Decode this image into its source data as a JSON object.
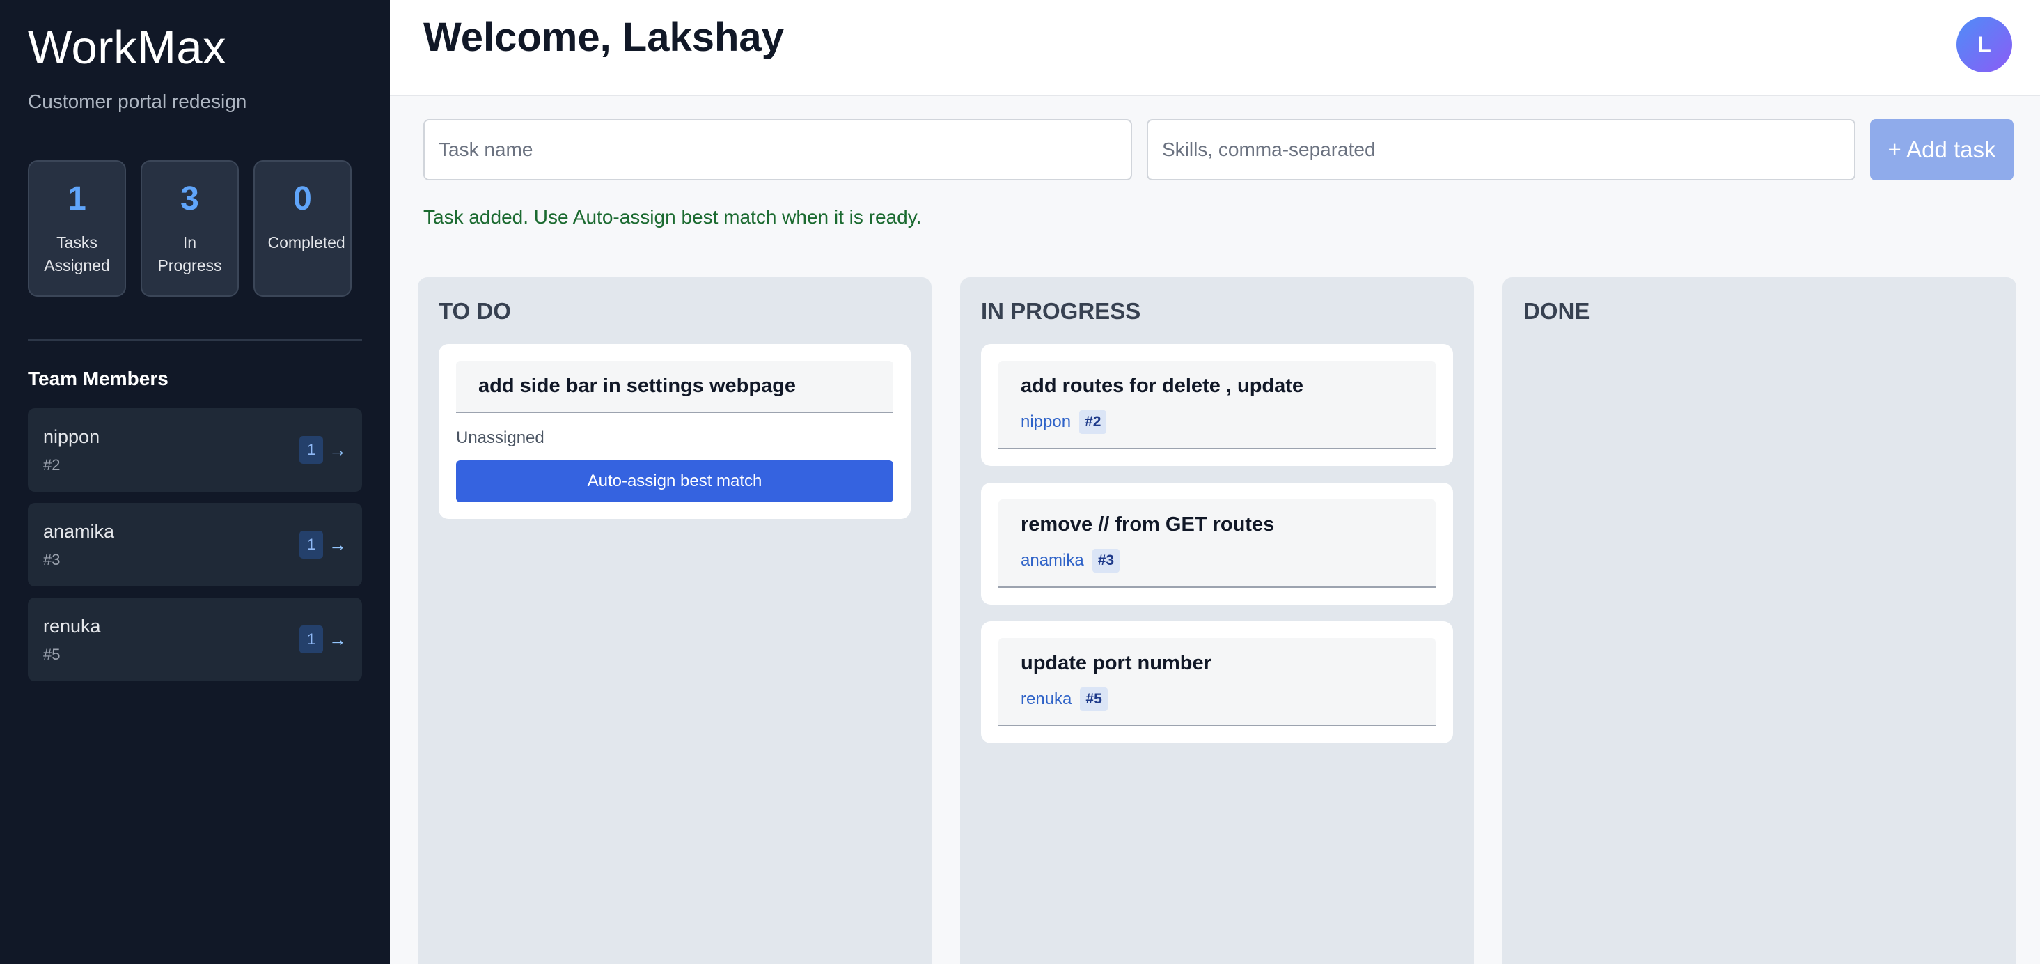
{
  "app": {
    "name": "WorkMax",
    "project": "Customer portal redesign"
  },
  "stats": [
    {
      "value": "1",
      "label": "Tasks Assigned"
    },
    {
      "value": "3",
      "label": "In Progress"
    },
    {
      "value": "0",
      "label": "Completed"
    }
  ],
  "team": {
    "title": "Team Members",
    "members": [
      {
        "name": "nippon",
        "id": "#2",
        "count": "1",
        "arrow": "→"
      },
      {
        "name": "anamika",
        "id": "#3",
        "count": "1",
        "arrow": "→"
      },
      {
        "name": "renuka",
        "id": "#5",
        "count": "1",
        "arrow": "→"
      }
    ]
  },
  "header": {
    "welcome": "Welcome, Lakshay",
    "avatar_initial": "L"
  },
  "form": {
    "task_placeholder": "Task name",
    "skills_placeholder": "Skills, comma-separated",
    "add_label": "+ Add task",
    "notice": "Task added. Use Auto-assign best match when it is ready."
  },
  "board": {
    "todo": {
      "title": "TO DO",
      "cards": [
        {
          "title": "add side bar in settings webpage",
          "status": "Unassigned",
          "action": "Auto-assign best match"
        }
      ]
    },
    "in_progress": {
      "title": "IN PROGRESS",
      "cards": [
        {
          "title": "add routes for delete , update",
          "assignee": "nippon",
          "badge": "#2"
        },
        {
          "title": "remove // from GET routes",
          "assignee": "anamika",
          "badge": "#3"
        },
        {
          "title": "update port number",
          "assignee": "renuka",
          "badge": "#5"
        }
      ]
    },
    "done": {
      "title": "DONE",
      "cards": []
    }
  },
  "colors": {
    "sidebar_bg": "#111827",
    "accent": "#3563e0",
    "stat_number": "#60a5fa",
    "notice_text": "#1b6a30"
  }
}
